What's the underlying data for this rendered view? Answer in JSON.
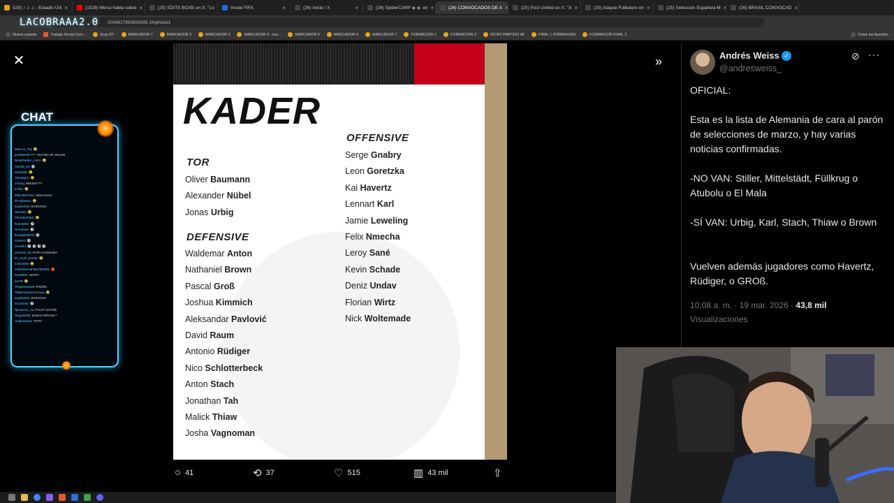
{
  "browser": {
    "tabs": [
      {
        "label": "528) ♪ ♫ ♫ - Estadio Úni",
        "color": "#e8a317",
        "active": false
      },
      {
        "label": "(1528) Messi habla sobre",
        "color": "#ff0000",
        "active": false
      },
      {
        "label": "(25) EDITS BOXE en X: \"Lo",
        "color": "#444444",
        "active": false
      },
      {
        "label": "Inside FIFA",
        "color": "#1d6fe0",
        "active": false
      },
      {
        "label": "(26) Inicio / X",
        "color": "#444444",
        "active": false
      },
      {
        "label": "(26) SpiderCARP ◈ ◈: en",
        "color": "#444444",
        "active": false
      },
      {
        "label": "(26) CONVOCADOS DE A",
        "color": "#444444",
        "active": true
      },
      {
        "label": "(25) Post United en X: \"A",
        "color": "#444444",
        "active": false
      },
      {
        "label": "(25) Ataque Futbolero en",
        "color": "#444444",
        "active": false
      },
      {
        "label": "(25) Selección Española M",
        "color": "#444444",
        "active": false
      },
      {
        "label": "(26) BRASIL CONVOCAD",
        "color": "#444444",
        "active": false
      }
    ],
    "address": "2034617893929165 24/photo/1",
    "bookmarks": [
      "Nueva carpeta",
      "Trabajo Social Com...",
      "Gran DT",
      "MARCADOR 1",
      "MARCADOR 2",
      "MARCADOR 3",
      "MARCADOR 4 - ove...",
      "MARCADOR 5",
      "MARCADOR 6",
      "MARCADOR 7",
      "FORMACION 1",
      "FORMACION 2",
      "INTRO PARTIDO 4K",
      "FINAL 1 FORMACION",
      "FORMACION FINAL 2"
    ],
    "all_bookmarks": "Todos los favoritos"
  },
  "stream": {
    "logo": "LACOBRAAA2.0",
    "chat_title": "CHAT",
    "chat_messages": [
      {
        "user": "Marcos_7tq",
        "text": ": 😂"
      },
      {
        "user": "javiidlander77",
        "text": ": YouTube de Neymar"
      },
      {
        "user": "NinjaRaider_cAKc",
        "text": ": 😂"
      },
      {
        "user": "Harold_z0",
        "text": ": ⚽"
      },
      {
        "user": "edosaab",
        "text": ": 😂"
      },
      {
        "user": "Tomaspr1",
        "text": ": 😂"
      },
      {
        "user": "1Tiang",
        "text": ": MIEDO???"
      },
      {
        "user": "Enfrix",
        "text": ": 😂"
      },
      {
        "user": "EltinoBOO83",
        "text": ": cobra tenon"
      },
      {
        "user": "DrAdriasnn",
        "text": ": 😂"
      },
      {
        "user": "Kaylord19",
        "text": ": WHOOOO"
      },
      {
        "user": "olos443",
        "text": ": 😂"
      },
      {
        "user": "ThunderFlaG",
        "text": ": 😂"
      },
      {
        "user": "Ramo804",
        "text": ": ⚽"
      },
      {
        "user": "zircarlose",
        "text": ": ⚽"
      },
      {
        "user": "Ezequiel0818",
        "text": ": ⚽"
      },
      {
        "user": "S3KKH",
        "text": ": ⚽"
      },
      {
        "user": "conoRo",
        "text": ": ⚽ ⚽ ⚽ ⚽"
      },
      {
        "user": "armand_33",
        "text": ": PAPA ALEMANIA"
      },
      {
        "user": "El_michi_bonito",
        "text": ": 😂"
      },
      {
        "user": "CSE1929",
        "text": ": 😂"
      },
      {
        "user": "Johanhernandez082003",
        "text": ": 🔴"
      },
      {
        "user": "Roo9901",
        "text": ": WHO?"
      },
      {
        "user": "lan78",
        "text": ": 😂"
      },
      {
        "user": "Thejeremie28",
        "text": ": PADRE"
      },
      {
        "user": "TsBenndAlerzeLinea",
        "text": ": 😂"
      },
      {
        "user": "Kaylord19",
        "text": ": WHOOOO"
      },
      {
        "user": "zircarlose",
        "text": ": ⚽"
      },
      {
        "user": "ripmarmo_A3",
        "text": ": FALTA GOTZE"
      },
      {
        "user": "Diego0220",
        "text": ": DUELE BRASIL?"
      },
      {
        "user": "Andyreport1",
        "text": ": PAPA"
      }
    ]
  },
  "photo": {
    "title": "KADER",
    "sections": {
      "tor": "TOR",
      "defensive": "DEFENSIVE",
      "offensive": "OFFENSIVE"
    },
    "tor": [
      {
        "first": "Oliver",
        "last": "Baumann"
      },
      {
        "first": "Alexander",
        "last": "Nübel"
      },
      {
        "first": "Jonas",
        "last": "Urbig"
      }
    ],
    "defensive": [
      {
        "first": "Waldemar",
        "last": "Anton"
      },
      {
        "first": "Nathaniel",
        "last": "Brown"
      },
      {
        "first": "Pascal",
        "last": "Groß"
      },
      {
        "first": "Joshua",
        "last": "Kimmich"
      },
      {
        "first": "Aleksandar",
        "last": "Pavlović"
      },
      {
        "first": "David",
        "last": "Raum"
      },
      {
        "first": "Antonio",
        "last": "Rüdiger"
      },
      {
        "first": "Nico",
        "last": "Schlotterbeck"
      },
      {
        "first": "Anton",
        "last": "Stach"
      },
      {
        "first": "Jonathan",
        "last": "Tah"
      },
      {
        "first": "Malick",
        "last": "Thiaw"
      },
      {
        "first": "Josha",
        "last": "Vagnoman"
      }
    ],
    "offensive": [
      {
        "first": "Serge",
        "last": "Gnabry"
      },
      {
        "first": "Leon",
        "last": "Goretzka"
      },
      {
        "first": "Kai",
        "last": "Havertz"
      },
      {
        "first": "Lennart",
        "last": "Karl"
      },
      {
        "first": "Jamie",
        "last": "Leweling"
      },
      {
        "first": "Felix",
        "last": "Nmecha"
      },
      {
        "first": "Leroy",
        "last": "Sané"
      },
      {
        "first": "Kevin",
        "last": "Schade"
      },
      {
        "first": "Deniz",
        "last": "Undav"
      },
      {
        "first": "Florian",
        "last": "Wirtz"
      },
      {
        "first": "Nick",
        "last": "Woltemade"
      }
    ]
  },
  "actions": {
    "replies": "41",
    "reposts": "37",
    "likes": "515",
    "views": "43 mil"
  },
  "tweet": {
    "author": "Andrés Weiss",
    "handle": "@andresweiss_",
    "paragraphs": [
      "OFICIAL:",
      "Esta es la lista de Alemania de cara al parón de selecciones de marzo, y hay varias noticias confirmadas.",
      "-NO VAN: Stiller, Mittelstädt, Füllkrug o Atubolu o El Mala",
      "-SÍ VAN: Urbig, Karl, Stach, Thiaw o Brown",
      "Vuelven además jugadores como Havertz, Rüdiger, o GROß."
    ],
    "time": "10:08 a. m. · 19 mar. 2026 · ",
    "views_count": "43,8 mil",
    "views_label": "Visualizaciones"
  },
  "icons": {
    "close": "✕",
    "expand": "»",
    "reply": "💬",
    "repost": "⟲",
    "like": "♡",
    "views": "▥",
    "share": "⇧",
    "more": "···",
    "grok": "⊘"
  }
}
